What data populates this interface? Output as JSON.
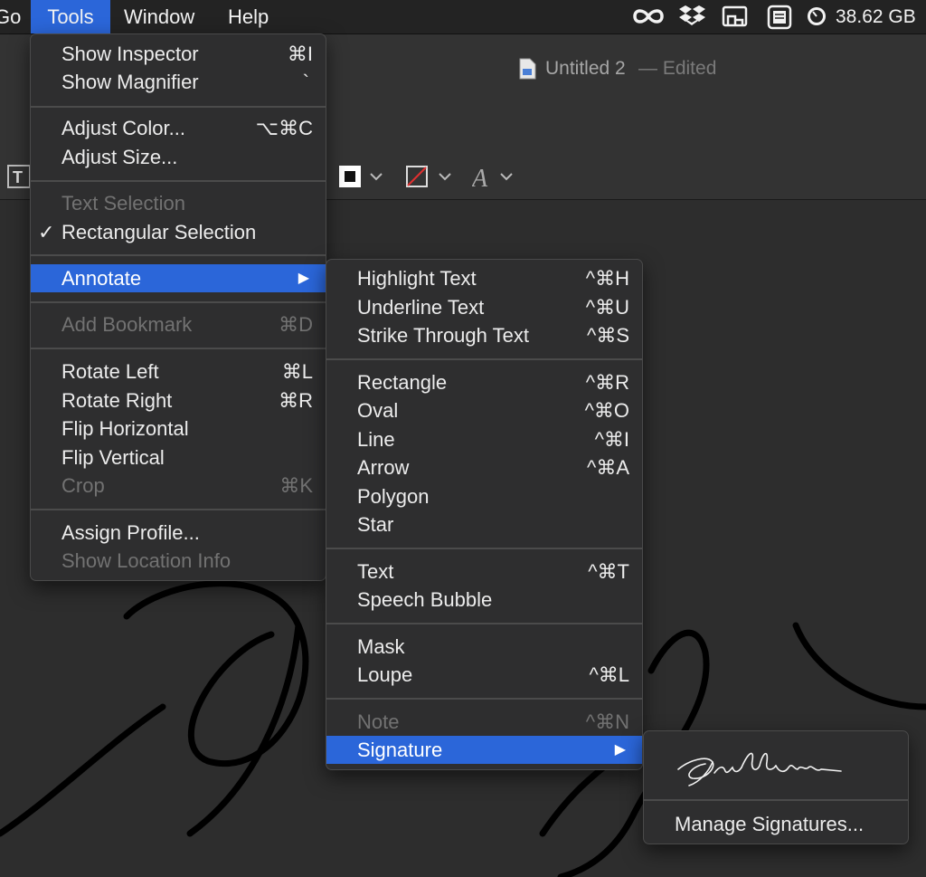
{
  "menubar": {
    "go": "Go",
    "tools": "Tools",
    "window": "Window",
    "help": "Help",
    "icons": [
      "infinity-icon",
      "dropbox-icon",
      "cast-icon",
      "clipboard-icon",
      "disk-gauge-icon"
    ],
    "disk_free": "38.62 GB"
  },
  "window": {
    "title": "Untitled 2",
    "edited": "— Edited"
  },
  "tools_menu": {
    "show_inspector": "Show Inspector",
    "show_inspector_sc": "⌘I",
    "show_magnifier": "Show Magnifier",
    "show_magnifier_sc": "`",
    "adjust_color": "Adjust Color...",
    "adjust_color_sc": "⌥⌘C",
    "adjust_size": "Adjust Size...",
    "text_selection": "Text Selection",
    "rect_selection": "Rectangular Selection",
    "checkmark": "✓",
    "annotate": "Annotate",
    "add_bookmark": "Add Bookmark",
    "add_bookmark_sc": "⌘D",
    "rotate_left": "Rotate Left",
    "rotate_left_sc": "⌘L",
    "rotate_right": "Rotate Right",
    "rotate_right_sc": "⌘R",
    "flip_h": "Flip Horizontal",
    "flip_v": "Flip Vertical",
    "crop": "Crop",
    "crop_sc": "⌘K",
    "assign_profile": "Assign Profile...",
    "show_location": "Show Location Info"
  },
  "annotate_menu": {
    "highlight": "Highlight Text",
    "highlight_sc": "^⌘H",
    "underline": "Underline Text",
    "underline_sc": "^⌘U",
    "strike": "Strike Through Text",
    "strike_sc": "^⌘S",
    "rectangle": "Rectangle",
    "rectangle_sc": "^⌘R",
    "oval": "Oval",
    "oval_sc": "^⌘O",
    "line": "Line",
    "line_sc": "^⌘I",
    "arrow": "Arrow",
    "arrow_sc": "^⌘A",
    "polygon": "Polygon",
    "star": "Star",
    "text": "Text",
    "text_sc": "^⌘T",
    "speech": "Speech Bubble",
    "mask": "Mask",
    "loupe": "Loupe",
    "loupe_sc": "^⌘L",
    "note": "Note",
    "note_sc": "^⌘N",
    "signature": "Signature"
  },
  "signature_menu": {
    "manage": "Manage Signatures..."
  },
  "colors": {
    "highlight": "#2b66d9",
    "menu_bg": "#2e2e2f",
    "disabled_text": "#727272"
  }
}
